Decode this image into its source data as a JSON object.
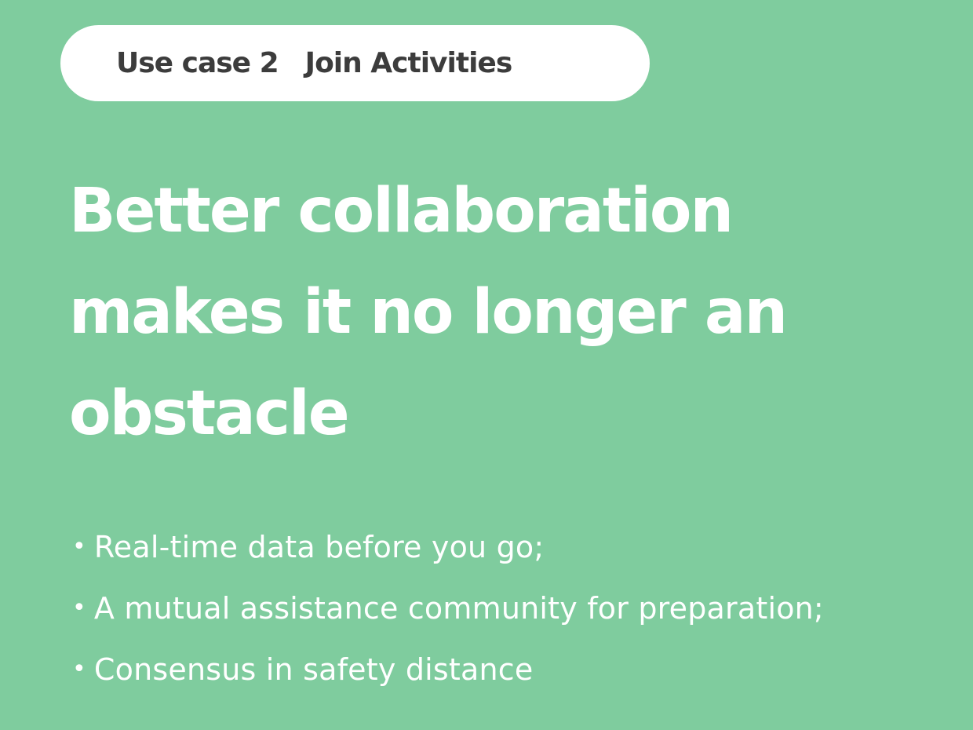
{
  "tag": {
    "case_label": "Use case 2",
    "case_title": "Join Activities"
  },
  "headline": {
    "lines": [
      "Better collaboration",
      "makes it no longer an",
      "obstacle"
    ]
  },
  "bullets": [
    "Real-time data before you go;",
    "A mutual assistance community for preparation;",
    "Consensus in safety distance"
  ],
  "colors": {
    "background": "#7fcc9e",
    "pill": "#ffffff",
    "pill_text": "#3c3c3c",
    "text": "#ffffff"
  }
}
